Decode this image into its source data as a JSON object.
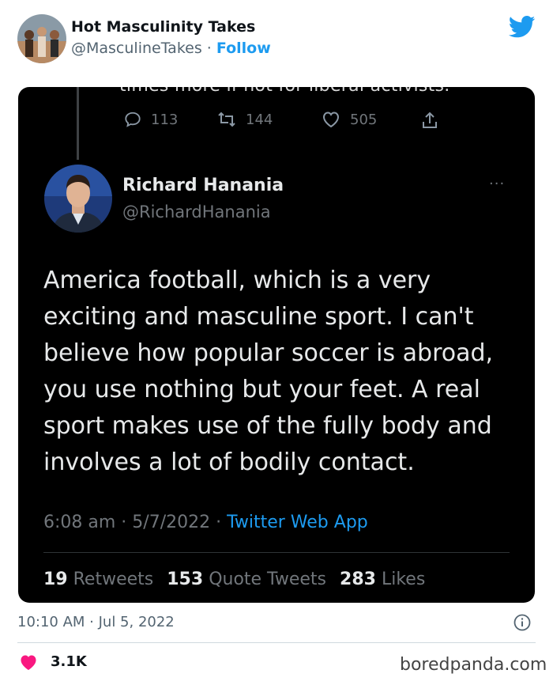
{
  "embed": {
    "author_name": "Hot Masculinity Takes",
    "author_handle": "@MasculineTakes",
    "separator": " · ",
    "follow_label": "Follow",
    "timestamp": "10:10 AM · Jul 5, 2022",
    "like_count": "3.1K"
  },
  "screenshot": {
    "previous_tweet_fragment": "times more if not for liberal activists.",
    "previous_actions": {
      "replies": "113",
      "retweets": "144",
      "likes": "505"
    },
    "quoted": {
      "name": "Richard Hanania",
      "handle": "@RichardHanania",
      "more": "···",
      "text_lines": [
        "America football, which is a very",
        "exciting and masculine sport. I can't",
        "believe how popular soccer is abroad,",
        "you use nothing but your feet. A real",
        "sport makes use of the fully body and",
        "involves a lot of bodily contact."
      ],
      "time": "6:08 am · 5/7/2022 · ",
      "app": "Twitter Web App",
      "stats": {
        "retweets": "19",
        "retweets_label": "Retweets",
        "quote_tweets": "153",
        "quote_tweets_label": "Quote Tweets",
        "likes": "283",
        "likes_label": "Likes"
      }
    }
  },
  "watermark": "boredpanda.com",
  "colors": {
    "twitter_blue": "#1d9bf0",
    "like_pink": "#f91880",
    "dark_bg": "#000000"
  }
}
